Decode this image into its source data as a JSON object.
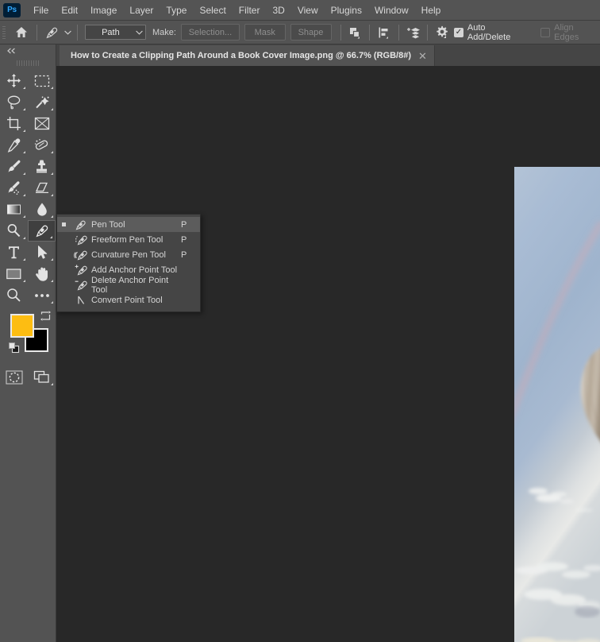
{
  "app": {
    "logo_text": "Ps"
  },
  "menubar": {
    "items": [
      {
        "label": "File"
      },
      {
        "label": "Edit"
      },
      {
        "label": "Image"
      },
      {
        "label": "Layer"
      },
      {
        "label": "Type"
      },
      {
        "label": "Select"
      },
      {
        "label": "Filter"
      },
      {
        "label": "3D"
      },
      {
        "label": "View"
      },
      {
        "label": "Plugins"
      },
      {
        "label": "Window"
      },
      {
        "label": "Help"
      }
    ]
  },
  "optionsbar": {
    "home_icon": "home-icon",
    "tool_icon": "pen-tool-icon",
    "tool_preset_caret": "chevron-down-icon",
    "mode_select": {
      "value": "Path",
      "caret": "chevron-down-icon"
    },
    "make_label": "Make:",
    "buttons": [
      {
        "label": "Selection...",
        "name": "make-selection-button"
      },
      {
        "label": "Mask",
        "name": "make-mask-button"
      },
      {
        "label": "Shape",
        "name": "make-shape-button"
      }
    ],
    "path_operations_icon": "path-operations-icon",
    "path_alignment_icon": "path-alignment-icon",
    "path_arrangement_icon": "path-arrangement-icon",
    "settings_icon": "gear-icon",
    "auto_add_delete": {
      "label": "Auto Add/Delete",
      "checked": true
    },
    "align_edges": {
      "label": "Align Edges",
      "checked": false,
      "disabled": true
    }
  },
  "toolbar": {
    "collapse_label": "«",
    "tools": [
      {
        "name": "move-tool",
        "icon": "move-icon",
        "has_flyout": true
      },
      {
        "name": "rectangular-marquee-tool",
        "icon": "marquee-icon",
        "has_flyout": true
      },
      {
        "name": "lasso-tool",
        "icon": "lasso-icon",
        "has_flyout": true
      },
      {
        "name": "object-selection-tool",
        "icon": "magic-wand-icon",
        "has_flyout": true
      },
      {
        "name": "crop-tool",
        "icon": "crop-icon",
        "has_flyout": true
      },
      {
        "name": "frame-tool",
        "icon": "frame-icon",
        "has_flyout": false
      },
      {
        "name": "eyedropper-tool",
        "icon": "eyedropper-icon",
        "has_flyout": true
      },
      {
        "name": "spot-healing-brush-tool",
        "icon": "healing-brush-icon",
        "has_flyout": true
      },
      {
        "name": "brush-tool",
        "icon": "brush-icon",
        "has_flyout": true
      },
      {
        "name": "clone-stamp-tool",
        "icon": "stamp-icon",
        "has_flyout": true
      },
      {
        "name": "history-brush-tool",
        "icon": "history-brush-icon",
        "has_flyout": true
      },
      {
        "name": "eraser-tool",
        "icon": "eraser-icon",
        "has_flyout": true
      },
      {
        "name": "gradient-tool",
        "icon": "gradient-icon",
        "has_flyout": true
      },
      {
        "name": "blur-tool",
        "icon": "blur-drop-icon",
        "has_flyout": true
      },
      {
        "name": "dodge-tool",
        "icon": "dodge-icon",
        "has_flyout": true
      },
      {
        "name": "pen-tool",
        "icon": "pen-tool-icon",
        "has_flyout": true,
        "selected": true
      },
      {
        "name": "horizontal-type-tool",
        "icon": "type-t-icon",
        "has_flyout": true
      },
      {
        "name": "path-selection-tool",
        "icon": "path-arrow-icon",
        "has_flyout": true
      },
      {
        "name": "rectangle-tool",
        "icon": "rectangle-shape-icon",
        "has_flyout": true
      },
      {
        "name": "hand-tool",
        "icon": "hand-icon",
        "has_flyout": true
      },
      {
        "name": "zoom-tool",
        "icon": "magnifier-icon",
        "has_flyout": false
      },
      {
        "name": "edit-toolbar-tool",
        "icon": "ellipsis-icon",
        "has_flyout": true
      }
    ],
    "colors": {
      "foreground": "#FDBD12",
      "background": "#000000",
      "swap_icon": "swap-colors-icon",
      "default_icon": "default-colors-icon"
    },
    "bottom_tools": [
      {
        "name": "quick-mask-button",
        "icon": "quick-mask-icon"
      },
      {
        "name": "screen-mode-button",
        "icon": "screen-mode-icon",
        "has_flyout": true
      }
    ]
  },
  "document": {
    "tab_title": "How to Create a Clipping Path Around a Book Cover Image.png @ 66.7% (RGB/8#)",
    "close_icon": "close-icon",
    "canvas_bg": "#282828",
    "image_description": "hot-air-balloon-in-blue-sky"
  },
  "flyout_menu": {
    "name": "pen-tool-flyout",
    "items": [
      {
        "label": "Pen Tool",
        "shortcut": "P",
        "icon": "pen-tool-icon",
        "active": true,
        "bullet": true
      },
      {
        "label": "Freeform Pen Tool",
        "shortcut": "P",
        "icon": "freeform-pen-icon",
        "active": false,
        "bullet": false
      },
      {
        "label": "Curvature Pen Tool",
        "shortcut": "P",
        "icon": "curvature-pen-icon",
        "active": false,
        "bullet": false
      },
      {
        "label": "Add Anchor Point Tool",
        "shortcut": "",
        "icon": "add-anchor-point-icon",
        "active": false,
        "bullet": false
      },
      {
        "label": "Delete Anchor Point Tool",
        "shortcut": "",
        "icon": "delete-anchor-point-icon",
        "active": false,
        "bullet": false
      },
      {
        "label": "Convert Point Tool",
        "shortcut": "",
        "icon": "convert-point-icon",
        "active": false,
        "bullet": false
      }
    ]
  }
}
